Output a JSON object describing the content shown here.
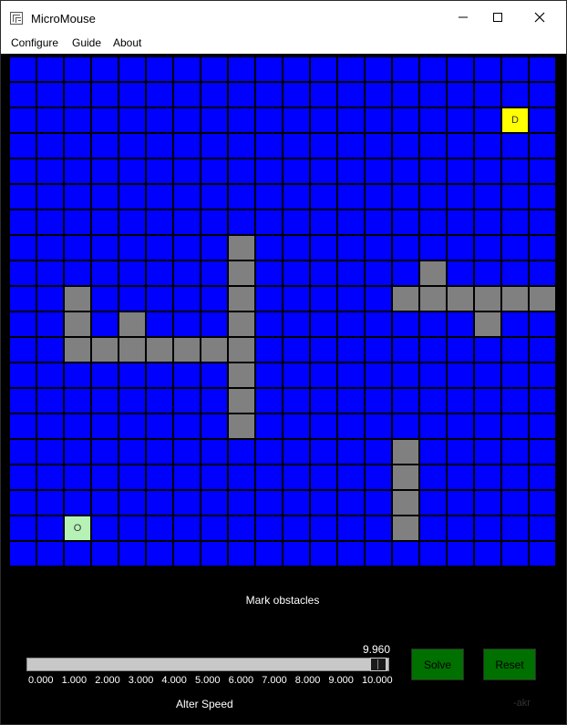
{
  "window": {
    "title": "MicroMouse",
    "controls": [
      "minimize",
      "maximize",
      "close"
    ]
  },
  "menu": [
    "Configure",
    "Guide",
    "About"
  ],
  "maze": {
    "rows": 20,
    "cols": 20,
    "colors": {
      "empty": "#0000ff",
      "obstacle": "#808080",
      "origin": "#b6f2b6",
      "destination": "#ffff00"
    },
    "obstacles": [
      [
        7,
        8
      ],
      [
        8,
        8
      ],
      [
        9,
        8
      ],
      [
        10,
        8
      ],
      [
        11,
        8
      ],
      [
        12,
        8
      ],
      [
        13,
        8
      ],
      [
        14,
        8
      ],
      [
        9,
        2
      ],
      [
        10,
        2
      ],
      [
        11,
        2
      ],
      [
        11,
        3
      ],
      [
        10,
        4
      ],
      [
        11,
        4
      ],
      [
        11,
        5
      ],
      [
        11,
        6
      ],
      [
        11,
        7
      ],
      [
        8,
        15
      ],
      [
        9,
        14
      ],
      [
        9,
        15
      ],
      [
        9,
        16
      ],
      [
        9,
        17
      ],
      [
        9,
        18
      ],
      [
        9,
        19
      ],
      [
        10,
        17
      ],
      [
        15,
        14
      ],
      [
        16,
        14
      ],
      [
        17,
        14
      ],
      [
        18,
        14
      ]
    ],
    "origin": {
      "row": 18,
      "col": 2,
      "label": "O"
    },
    "destination": {
      "row": 2,
      "col": 18,
      "label": "D"
    }
  },
  "status_text": "Mark obstacles",
  "speed_slider": {
    "value": 9.96,
    "value_label": "9.960",
    "min": 0,
    "max": 10,
    "tick_labels": [
      "0.000",
      "1.000",
      "2.000",
      "3.000",
      "4.000",
      "5.000",
      "6.000",
      "7.000",
      "8.000",
      "9.000",
      "10.000"
    ],
    "caption": "Alter Speed"
  },
  "buttons": {
    "solve": "Solve",
    "reset": "Reset",
    "color": "#007000"
  },
  "signature": "-akr"
}
